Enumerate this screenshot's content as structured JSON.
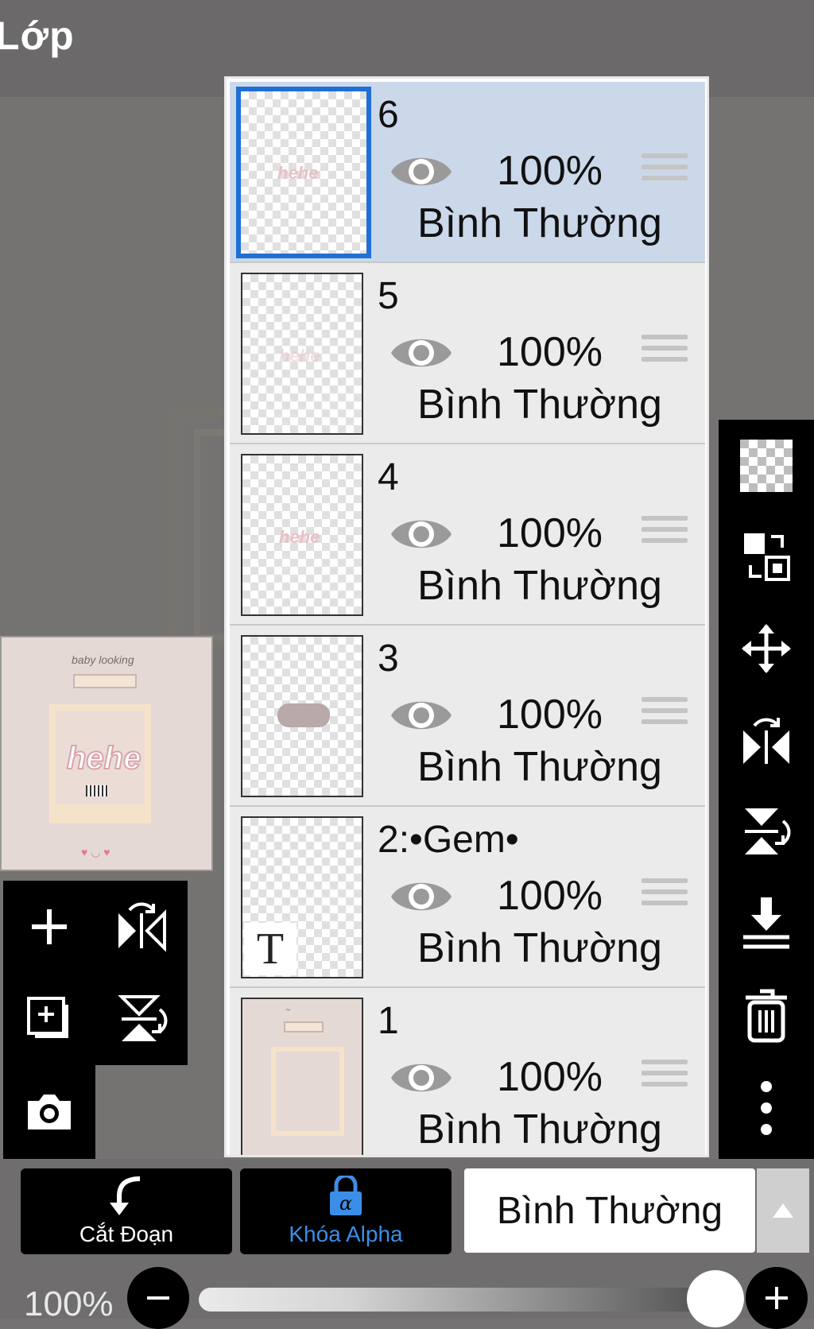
{
  "app": {
    "title": "Lớp"
  },
  "layers": [
    {
      "name": "6",
      "opacity": "100%",
      "mode": "Bình Thường",
      "selected": true,
      "thumb": "hehe text"
    },
    {
      "name": "5",
      "opacity": "100%",
      "mode": "Bình Thường",
      "selected": false,
      "thumb": "faint hehe"
    },
    {
      "name": "4",
      "opacity": "100%",
      "mode": "Bình Thường",
      "selected": false,
      "thumb": "hehe text"
    },
    {
      "name": "3",
      "opacity": "100%",
      "mode": "Bình Thường",
      "selected": false,
      "thumb": "cloud shape"
    },
    {
      "name": "2:•Gem•",
      "opacity": "100%",
      "mode": "Bình Thường",
      "selected": false,
      "thumb": "text layer"
    },
    {
      "name": "1",
      "opacity": "100%",
      "mode": "Bình Thường",
      "selected": false,
      "thumb": "background"
    }
  ],
  "preview": {
    "canvas_text": "hehe",
    "small_text": "baby looking"
  },
  "left_tools": [
    "add-layer-icon",
    "flip-horizontal-icon",
    "add-layer-copy-icon",
    "flip-vertical-icon",
    "camera-icon"
  ],
  "right_tools": [
    "transparency-icon",
    "swap-layers-icon",
    "move-icon",
    "flip-horizontal-icon",
    "flip-vertical-icon",
    "merge-down-icon",
    "trash-icon",
    "more-icon"
  ],
  "bottom": {
    "clip_label": "Cắt Đoạn",
    "alpha_lock_label": "Khóa Alpha",
    "blend_mode": "Bình Thường",
    "opacity_label": "100%",
    "opacity_value": 1.0
  },
  "colors": {
    "selected_layer": "#cbd8ea",
    "accent": "#1f6fd6",
    "alpha_lock": "#3b8ee8"
  }
}
